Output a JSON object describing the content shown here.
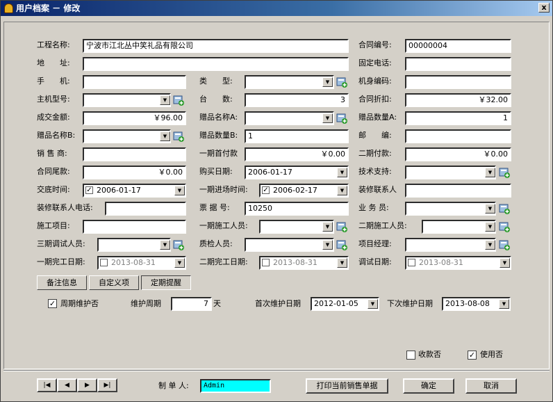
{
  "window": {
    "title": "用户档案 － 修改",
    "close": "x"
  },
  "fields": {
    "project_name_label": "工程名称:",
    "project_name": "宁波市江北丛中笑礼品有限公司",
    "contract_no_label": "合同编号:",
    "contract_no": "00000004",
    "address_label": "地　　址:",
    "address": "",
    "fixed_phone_label": "固定电话:",
    "fixed_phone": "",
    "mobile_label": "手　　机:",
    "mobile": "",
    "type_label": "类　　型:",
    "type": "",
    "body_code_label": "机身编码:",
    "body_code": "",
    "host_model_label": "主机型号:",
    "host_model": "",
    "units_label": "台　　数:",
    "units": "3",
    "contract_discount_label": "合同折扣:",
    "contract_discount": "￥32.00",
    "deal_amount_label": "成交金额:",
    "deal_amount": "￥96.00",
    "gift_name_a_label": "赠品名称A:",
    "gift_name_a": "",
    "gift_qty_a_label": "赠品数量A:",
    "gift_qty_a": "1",
    "gift_name_b_label": "赠品名称B:",
    "gift_name_b": "",
    "gift_qty_b_label": "赠品数量B:",
    "gift_qty_b": "1",
    "postcode_label": "邮　　编:",
    "postcode": "",
    "dealer_label": "销 售 商:",
    "dealer": "",
    "first_payment_label": "一期首付款",
    "first_payment": "￥0.00",
    "second_payment_label": "二期付款:",
    "second_payment": "￥0.00",
    "final_payment_label": "合同尾款:",
    "final_payment": "￥0.00",
    "purchase_date_label": "购买日期:",
    "purchase_date": "2006-01-17",
    "tech_support_label": "技术支持:",
    "tech_support": "",
    "handover_time_label": "交底时间:",
    "handover_time": "2006-01-17",
    "phase1_entry_label": "一期进场时间:",
    "phase1_entry": "2006-02-17",
    "decor_contact_label": "装修联系人",
    "decor_contact": "",
    "decor_phone_label": "装修联系人电话:",
    "decor_phone": "",
    "receipt_no_label": "票 据 号:",
    "receipt_no": "10250",
    "salesman_label": "业 务 员:",
    "salesman": "",
    "construction_item_label": "施工项目:",
    "construction_item": "",
    "phase1_staff_label": "一期施工人员:",
    "phase1_staff": "",
    "phase2_staff_label": "二期施工人员:",
    "phase2_staff": "",
    "phase3_debug_label": "三期调试人员:",
    "phase3_debug": "",
    "qc_staff_label": "质检人员:",
    "qc_staff": "",
    "pm_label": "项目经理:",
    "pm": "",
    "phase1_done_label": "一期完工日期:",
    "phase1_done": "2013-08-31",
    "phase2_done_label": "二期完工日期:",
    "phase2_done": "2013-08-31",
    "debug_date_label": "调试日期:",
    "debug_date": "2013-08-31"
  },
  "tabs": [
    "备注信息",
    "自定义项",
    "定期提醒"
  ],
  "reminder": {
    "periodic_label": "周期维护否",
    "period_label": "维护周期",
    "period_value": "7",
    "period_unit": "天",
    "first_date_label": "首次维护日期",
    "first_date": "2012-01-05",
    "next_date_label": "下次维护日期",
    "next_date": "2013-08-08"
  },
  "flags": {
    "paid_label": "收款否",
    "used_label": "使用否"
  },
  "footer": {
    "creator_label": "制 单 人:",
    "creator": "Admin",
    "print_button": "打印当前销售单据",
    "ok_button": "确定",
    "cancel_button": "取消"
  },
  "nav": [
    "|◀",
    "◀",
    "▶",
    "▶|"
  ],
  "colors": {
    "title_start": "#0a246a",
    "creator_bg": "#00ffff"
  }
}
